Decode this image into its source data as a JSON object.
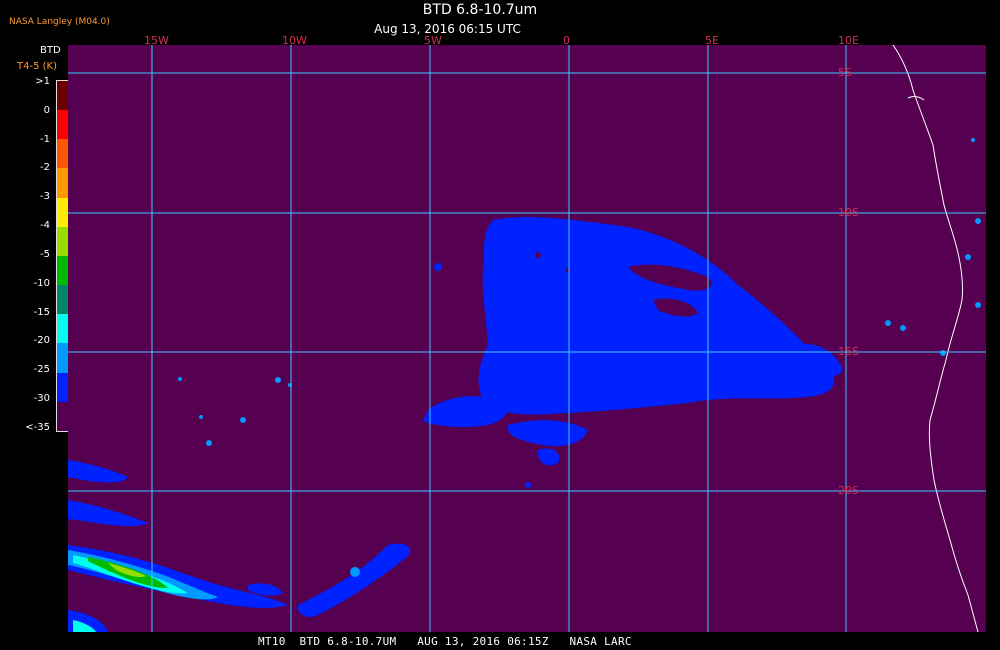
{
  "credit": "NASA Langley (M04.0)",
  "title": "BTD 6.8-10.7um",
  "subtitle": "Aug 13, 2016 06:15 UTC",
  "legend": {
    "title": "BTD",
    "subtitle": "T4-5 (K)",
    "labels": [
      ">1",
      "0",
      "-1",
      "-2",
      "-3",
      "-4",
      "-5",
      "-10",
      "-15",
      "-20",
      "-25",
      "-30",
      "<-35"
    ],
    "colors": [
      "#6a0000",
      "#ff0000",
      "#ff5500",
      "#ff9900",
      "#ffee00",
      "#99dd00",
      "#00bb00",
      "#008866",
      "#00ffee",
      "#0099ff",
      "#0022ff",
      "#550050"
    ]
  },
  "longitude_labels": [
    "15W",
    "10W",
    "5W",
    "0",
    "5E",
    "10E"
  ],
  "latitude_labels": [
    "5S",
    "10S",
    "15S",
    "20S"
  ],
  "bottom_caption": "MT10  BTD 6.8-10.7UM   AUG 13, 2016 06:15Z   NASA LARC",
  "colors": {
    "background": "#550050",
    "grid": "#40c8ff",
    "labels": "#d03050",
    "coast": "#ffffff"
  }
}
